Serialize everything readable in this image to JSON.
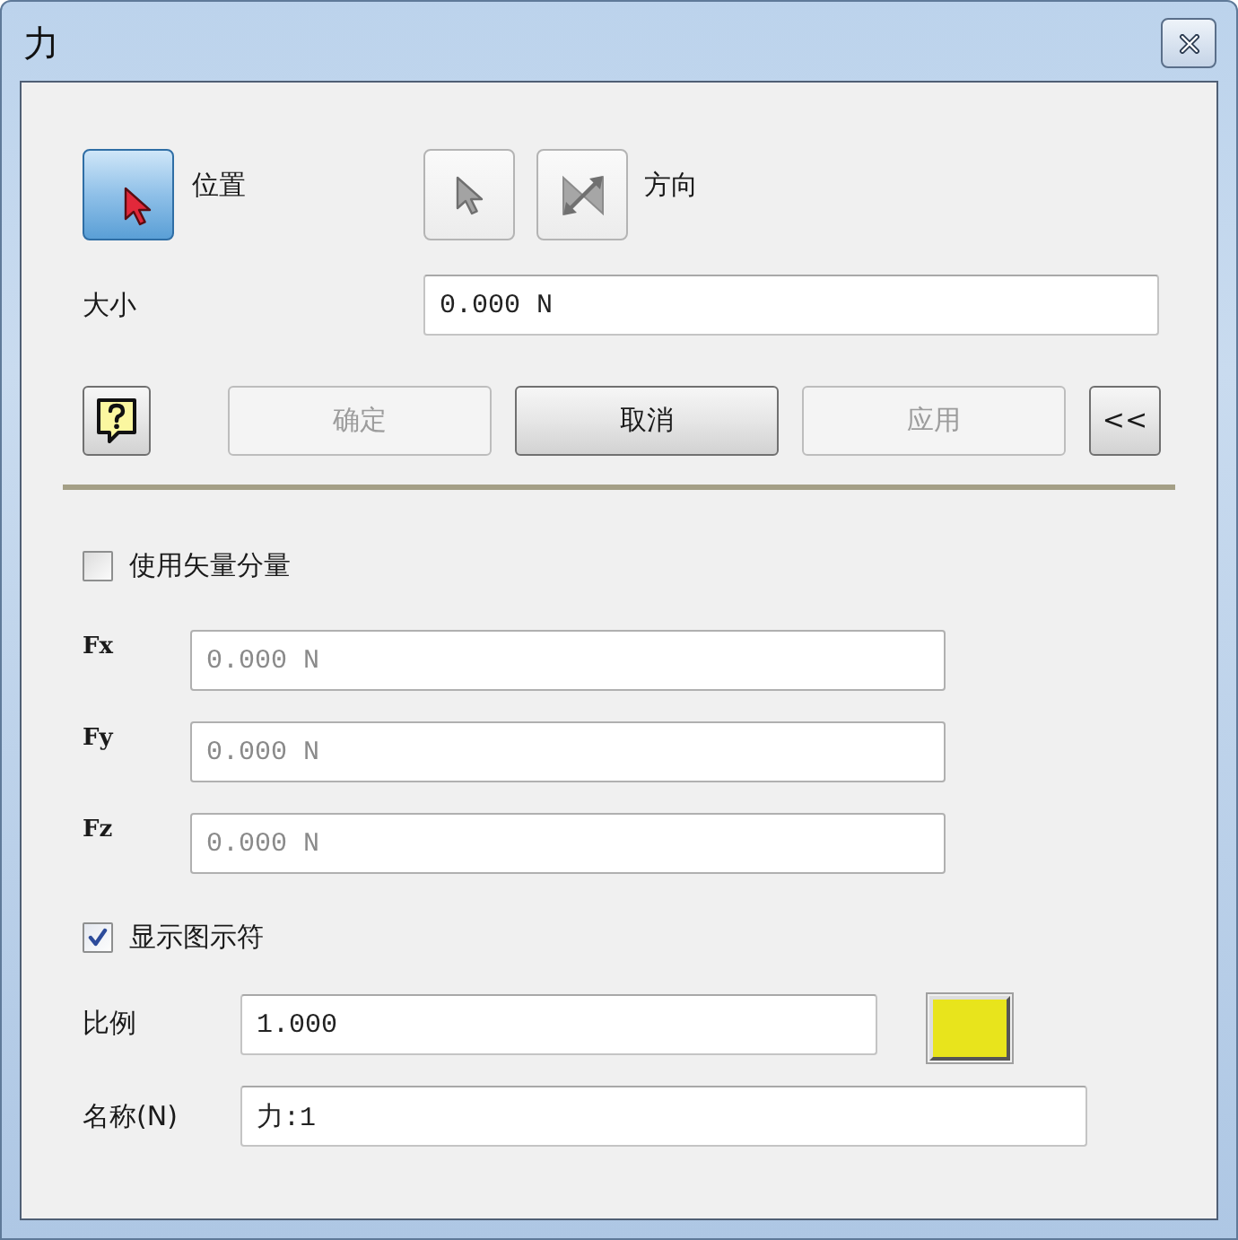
{
  "window": {
    "title": "力"
  },
  "position": {
    "label": "位置",
    "selected": true
  },
  "direction": {
    "label": "方向",
    "selected": false
  },
  "magnitude": {
    "label": "大小",
    "value": "0.000 N"
  },
  "buttons": [
    {
      "kind": "help",
      "disabled": false
    },
    {
      "kind": "action",
      "label": "确定",
      "disabled": true
    },
    {
      "kind": "action",
      "label": "取消",
      "disabled": false
    },
    {
      "kind": "action",
      "label": "应用",
      "disabled": true
    },
    {
      "kind": "collapse",
      "label": "<<",
      "disabled": false
    }
  ],
  "vector_components": {
    "label": "使用矢量分量",
    "checked": false,
    "fields": [
      {
        "label": "Fx",
        "value": "0.000 N"
      },
      {
        "label": "Fy",
        "value": "0.000 N"
      },
      {
        "label": "Fz",
        "value": "0.000 N"
      }
    ]
  },
  "show_glyph": {
    "label": "显示图示符",
    "checked": true
  },
  "scale": {
    "label": "比例",
    "value": "1.000",
    "color": "#e8e41c"
  },
  "name": {
    "label": "名称(N)",
    "value": "力:1"
  }
}
